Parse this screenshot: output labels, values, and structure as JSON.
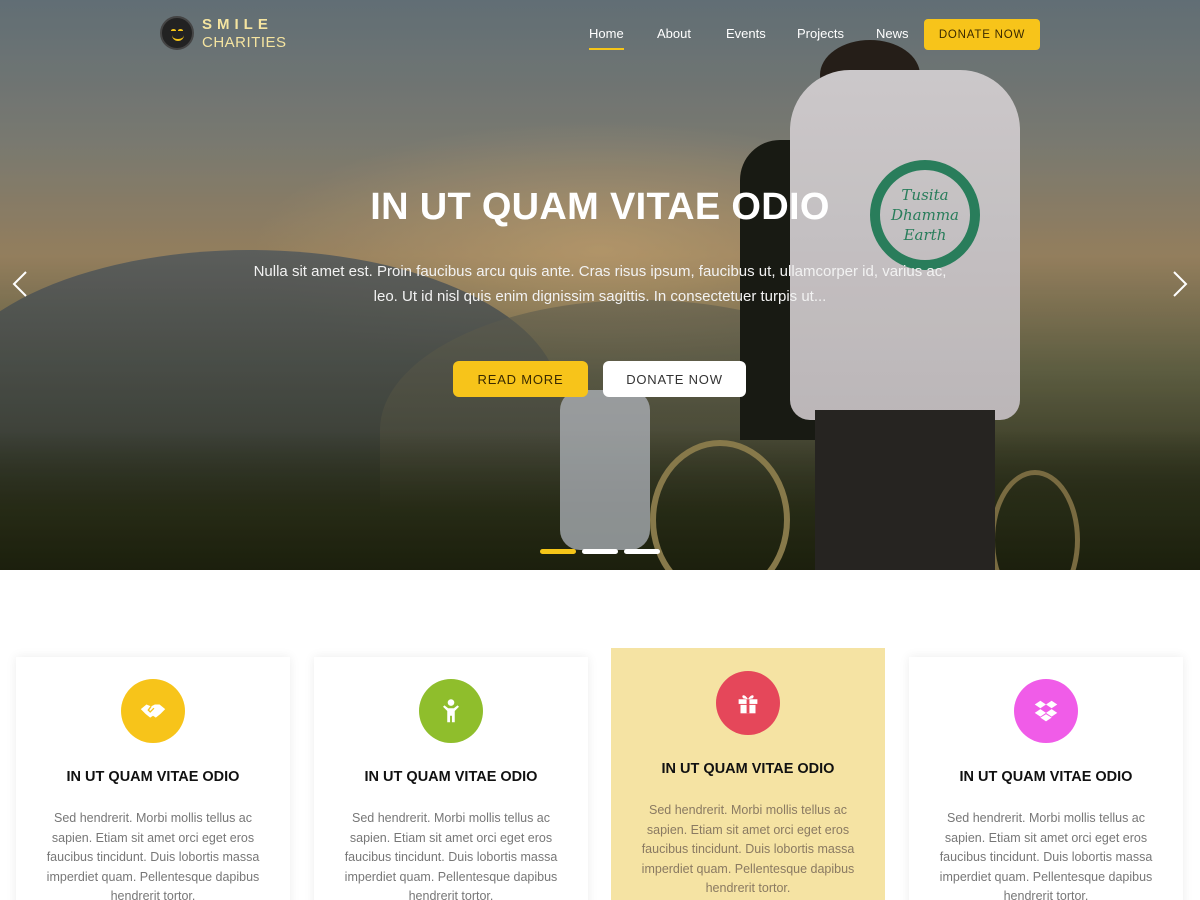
{
  "logo": {
    "line1": "SMILE",
    "line2": "CHARITIES"
  },
  "nav": {
    "items": [
      {
        "label": "Home",
        "active": true
      },
      {
        "label": "About",
        "active": false
      },
      {
        "label": "Events",
        "active": false
      },
      {
        "label": "Projects",
        "active": false
      },
      {
        "label": "News",
        "active": false
      }
    ],
    "donate_label": "DONATE NOW"
  },
  "hero": {
    "title": "IN UT QUAM VITAE ODIO",
    "description_line1": "Nulla sit amet est. Proin faucibus arcu quis ante. Cras risus ipsum, faucibus ut, ullamcorper id, varius ac,",
    "description_line2": "leo. Ut id nisl quis enim dignissim sagittis. In consectetuer turpis ut...",
    "read_more_label": "READ MORE",
    "donate_label": "DONATE NOW",
    "slide_count": 3,
    "active_slide": 1,
    "shirt_print_lines": [
      "Tusita",
      "Dhamma",
      "Earth"
    ]
  },
  "cards": [
    {
      "icon": "handshake-icon",
      "icon_color": "#f7c41a",
      "title": "IN UT QUAM VITAE ODIO",
      "text": "Sed hendrerit. Morbi mollis tellus ac sapien. Etiam sit amet orci eget eros faucibus tincidunt. Duis lobortis massa imperdiet quam. Pellentesque dapibus hendrerit tortor."
    },
    {
      "icon": "child-icon",
      "icon_color": "#8fbe2c",
      "title": "IN UT QUAM VITAE ODIO",
      "text": "Sed hendrerit. Morbi mollis tellus ac sapien. Etiam sit amet orci eget eros faucibus tincidunt. Duis lobortis massa imperdiet quam. Pellentesque dapibus hendrerit tortor."
    },
    {
      "icon": "gift-icon",
      "icon_color": "#e5475a",
      "title": "IN UT QUAM VITAE ODIO",
      "text": "Sed hendrerit. Morbi mollis tellus ac sapien. Etiam sit amet orci eget eros faucibus tincidunt. Duis lobortis massa imperdiet quam. Pellentesque dapibus hendrerit tortor.",
      "highlighted": true,
      "background": "#f5e3a3"
    },
    {
      "icon": "dropbox-icon",
      "icon_color": "#f05ce8",
      "title": "IN UT QUAM VITAE ODIO",
      "text": "Sed hendrerit. Morbi mollis tellus ac sapien. Etiam sit amet orci eget eros faucibus tincidunt. Duis lobortis massa imperdiet quam. Pellentesque dapibus hendrerit tortor."
    }
  ],
  "colors": {
    "accent": "#f7c41a",
    "white": "#ffffff"
  }
}
